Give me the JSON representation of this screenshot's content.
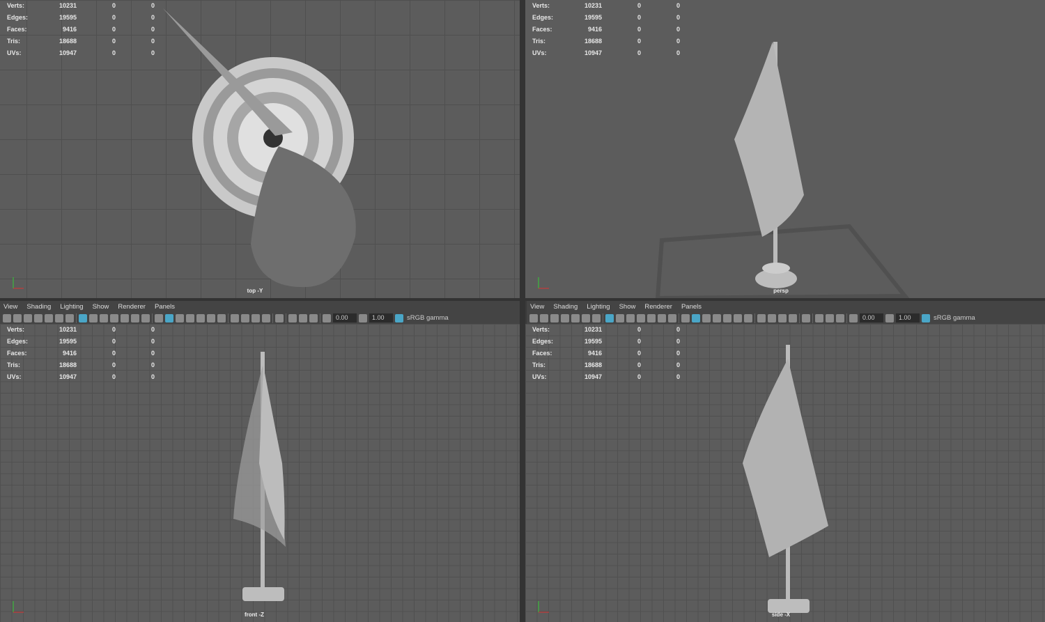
{
  "stats": [
    {
      "label": "Verts:",
      "value": "10231",
      "sel": "0",
      "comp": "0"
    },
    {
      "label": "Edges:",
      "value": "19595",
      "sel": "0",
      "comp": "0"
    },
    {
      "label": "Faces:",
      "value": "9416",
      "sel": "0",
      "comp": "0"
    },
    {
      "label": "Tris:",
      "value": "18688",
      "sel": "0",
      "comp": "0"
    },
    {
      "label": "UVs:",
      "value": "10947",
      "sel": "0",
      "comp": "0"
    }
  ],
  "panels": [
    {
      "camera": "top -Y"
    },
    {
      "camera": "persp"
    },
    {
      "camera": "front -Z"
    },
    {
      "camera": "side -X"
    }
  ],
  "menus": [
    "View",
    "Shading",
    "Lighting",
    "Show",
    "Renderer",
    "Panels"
  ],
  "toolbar": {
    "exposure": "0.00",
    "gamma": "1.00",
    "color_space": "sRGB gamma"
  },
  "toolbar_icons": [
    "camera-icon",
    "camera-attributes-icon",
    "bookmark-camera-icon",
    "bookmark-icon",
    "image-plane-icon",
    "2d-pan-zoom-icon",
    "grease-pencil-icon",
    "|",
    "grid-icon",
    "film-gate-icon",
    "resolution-gate-icon",
    "gate-mask-icon",
    "field-chart-icon",
    "safe-action-icon",
    "safe-title-icon",
    "|",
    "wireframe-icon",
    "smooth-shade-icon",
    "default-material-icon",
    "wireframe-on-shaded-icon",
    "textured-icon",
    "use-all-lights-icon",
    "shadows-icon",
    "|",
    "screen-space-ao-icon",
    "motion-blur-icon",
    "multisample-aa-icon",
    "depth-of-field-icon",
    "|",
    "isolate-select-icon",
    "|",
    "xray-icon",
    "xray-joints-icon",
    "xray-active-icon",
    "|",
    "exposure-icon"
  ],
  "colors": {
    "viewport": "#5c5c5c",
    "accent": "#4aa6c7",
    "panel": "#444444"
  }
}
